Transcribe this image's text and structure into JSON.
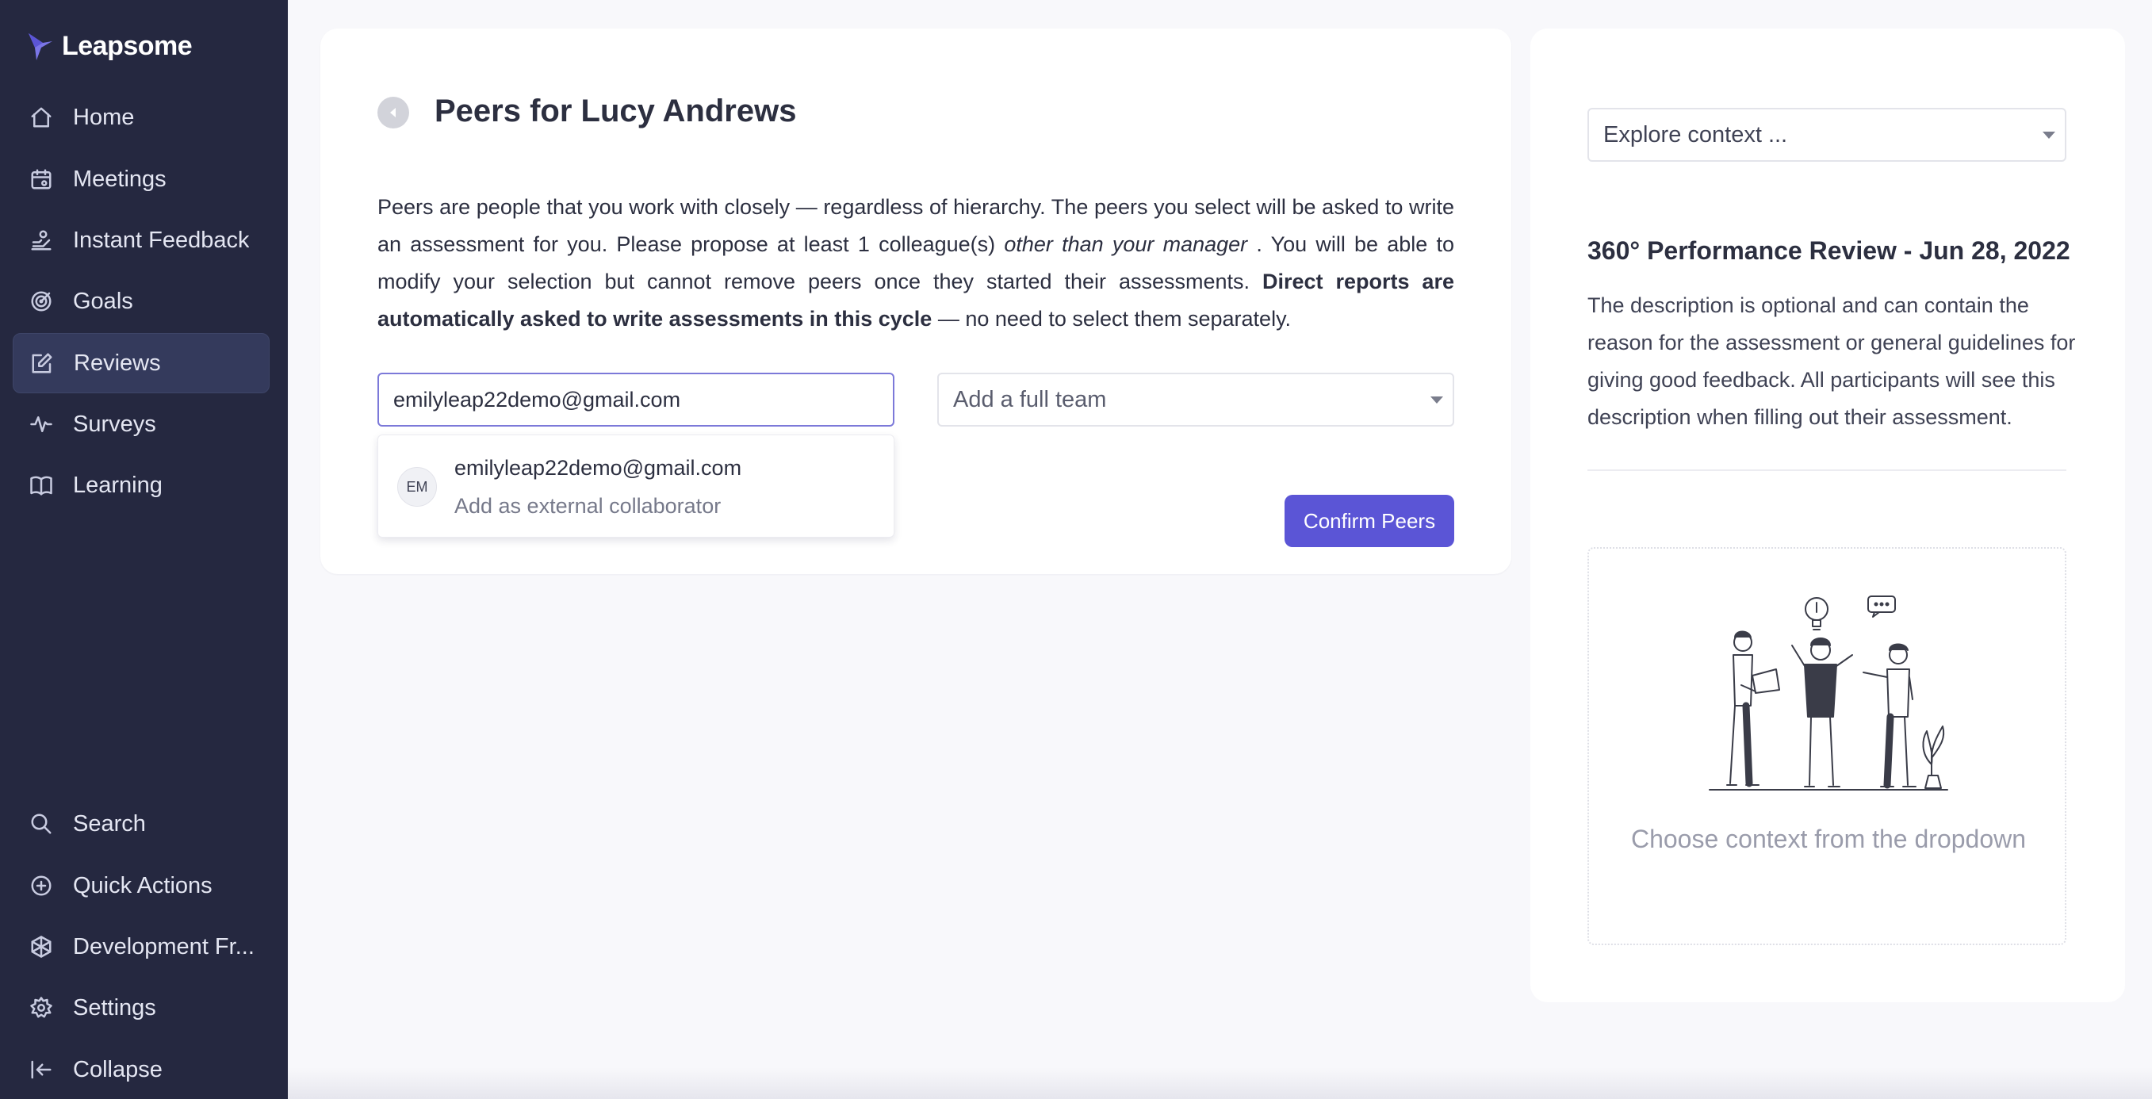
{
  "brand": {
    "name": "Leapsome"
  },
  "sidebar": {
    "items": [
      {
        "label": "Home",
        "icon": "home-icon"
      },
      {
        "label": "Meetings",
        "icon": "calendar-icon"
      },
      {
        "label": "Instant Feedback",
        "icon": "feedback-icon"
      },
      {
        "label": "Goals",
        "icon": "target-icon"
      },
      {
        "label": "Reviews",
        "icon": "edit-icon",
        "active": true
      },
      {
        "label": "Surveys",
        "icon": "pulse-icon"
      },
      {
        "label": "Learning",
        "icon": "book-icon"
      }
    ],
    "bottom_items": [
      {
        "label": "Search",
        "icon": "search-icon"
      },
      {
        "label": "Quick Actions",
        "icon": "plus-circle-icon"
      },
      {
        "label": "Development Fr...",
        "icon": "framework-icon"
      },
      {
        "label": "Settings",
        "icon": "gear-icon"
      },
      {
        "label": "Collapse",
        "icon": "collapse-icon"
      }
    ]
  },
  "main": {
    "title": "Peers for Lucy Andrews",
    "description": {
      "part1": "Peers are people that you work with closely — regardless of hierarchy. The peers you select will be asked to write an assessment for you. Please propose at least 1 colleague(s) ",
      "italic": "other than your manager",
      "part2": " . You will be able to modify your selection but cannot remove peers once they started their assessments. ",
      "bold": "Direct reports are automatically asked to write assessments in this cycle",
      "part3": " — no need to select them separately."
    },
    "peer_input_value": "emilyleap22demo@gmail.com",
    "team_select": "Add a full team",
    "suggestion": {
      "initials": "EM",
      "email": "emilyleap22demo@gmail.com",
      "subtitle": "Add as external collaborator"
    },
    "confirm_label": "Confirm Peers"
  },
  "context": {
    "select_label": "Explore context ...",
    "review_title": "360° Performance Review - Jun 28, 2022",
    "review_description": "The description is optional and can contain the reason for the assessment or general guidelines for giving good feedback. All participants will see this description when filling out their assessment.",
    "empty_text": "Choose context from the dropdown"
  },
  "colors": {
    "sidebar_bg": "#252840",
    "accent": "#5b55d6",
    "input_focus": "#7c79d9"
  }
}
